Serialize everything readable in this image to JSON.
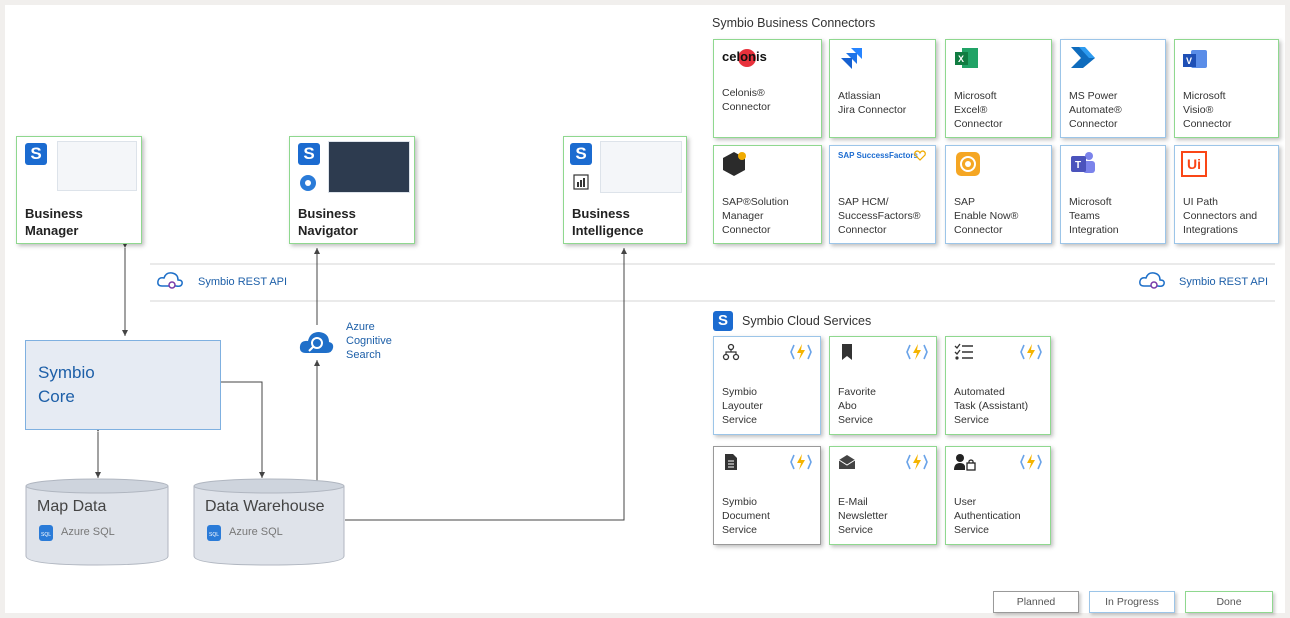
{
  "business_connectors": {
    "title": "Symbio Business Connectors",
    "tiles": [
      {
        "label": "Celonis®\nConnector",
        "logo_text": "celonis",
        "status": "Done"
      },
      {
        "label": "Atlassian\nJira Connector",
        "status": "Done"
      },
      {
        "label": "Microsoft\nExcel®\nConnector",
        "status": "Done"
      },
      {
        "label": "MS Power\nAutomate®\nConnector",
        "status": "In Progress"
      },
      {
        "label": "Microsoft\nVisio®\nConnector",
        "status": "Done"
      },
      {
        "label": "SAP®Solution\nManager\nConnector",
        "status": "Done"
      },
      {
        "label": "SAP HCM/\nSuccessFactors®\nConnector",
        "logo_text": "SAP SuccessFactors",
        "status": "In Progress"
      },
      {
        "label": "SAP\nEnable Now®\nConnector",
        "status": "In Progress"
      },
      {
        "label": "Microsoft\nTeams\nIntegration",
        "status": "In Progress"
      },
      {
        "label": "UI Path\nConnectors and\nIntegrations",
        "logo_text": "Ui",
        "status": "In Progress"
      }
    ]
  },
  "apps": [
    {
      "label": "Business\nManager",
      "status": "Done"
    },
    {
      "label": "Business\nNavigator",
      "status": "Done"
    },
    {
      "label": "Business\nIntelligence",
      "status": "Done"
    }
  ],
  "rest_api": {
    "left": "Symbio REST API",
    "right": "Symbio REST API"
  },
  "azure_search": {
    "label": "Azure\nCognitive\nSearch"
  },
  "core": {
    "label": "Symbio\nCore"
  },
  "databases": [
    {
      "label": "Map Data",
      "sub": "Azure SQL"
    },
    {
      "label": "Data Warehouse",
      "sub": "Azure SQL"
    }
  ],
  "cloud_services": {
    "title": "Symbio Cloud Services",
    "tiles": [
      {
        "label": "Symbio\nLayouter\nService",
        "icon": "hierarchy-icon",
        "status": "In Progress"
      },
      {
        "label": "Favorite\nAbo\nService",
        "icon": "bookmark-icon",
        "status": "Done"
      },
      {
        "label": "Automated\nTask (Assistant)\nService",
        "icon": "checklist-icon",
        "status": "Done"
      },
      {
        "label": "Symbio\nDocument\nService",
        "icon": "document-icon",
        "status": "Planned"
      },
      {
        "label": "E-Mail\nNewsletter\nService",
        "icon": "mail-icon",
        "status": "Done"
      },
      {
        "label": "User\nAuthentication\nService",
        "icon": "user-lock-icon",
        "status": "Done"
      }
    ]
  },
  "legend": {
    "planned": "Planned",
    "in_progress": "In Progress",
    "done": "Done"
  },
  "colors": {
    "done_border": "#8fd88f",
    "progress_border": "#9cc5e8",
    "planned_border": "#9a9a9a",
    "accent_blue": "#1b6bd0"
  }
}
